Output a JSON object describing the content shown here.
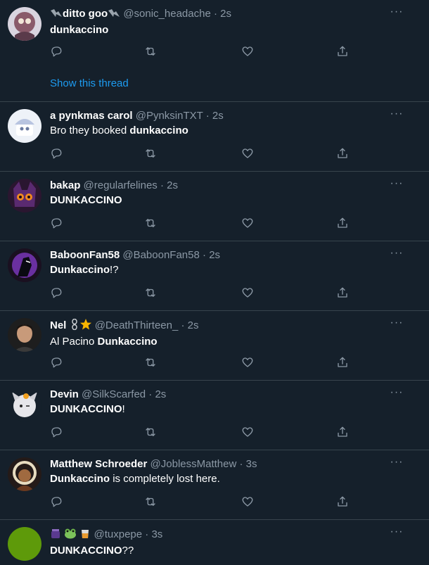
{
  "tweets": [
    {
      "name": "ditto goo",
      "handle": "@sonic_headache",
      "time": "2s",
      "pre": "",
      "bold": "dunkaccino",
      "post": "",
      "show_thread": "Show this thread",
      "avatar_color": "#7a6a8a"
    },
    {
      "name": "a pynkmas carol",
      "handle": "@PynksinTXT",
      "time": "2s",
      "pre": "Bro they booked ",
      "bold": "dunkaccino",
      "post": "",
      "avatar_color": "#cfd8e8"
    },
    {
      "name": "bakap",
      "handle": "@regularfelines",
      "time": "2s",
      "pre": "",
      "bold": "DUNKACCINO",
      "post": "",
      "avatar_color": "#3a1f3a"
    },
    {
      "name": "BaboonFan58",
      "handle": "@BaboonFan58",
      "time": "2s",
      "pre": "",
      "bold": "Dunkaccino",
      "post": "!?",
      "avatar_color": "#4a2a66"
    },
    {
      "name": "Nel",
      "handle": "@DeathThirteen_",
      "time": "2s",
      "pre": "Al Pacino ",
      "bold": "Dunkaccino",
      "post": "",
      "avatar_color": "#2b2b2b"
    },
    {
      "name": "Devin",
      "handle": "@SilkScarfed",
      "time": "2s",
      "pre": "",
      "bold": "DUNKACCINO",
      "post": "!",
      "avatar_color": "#e8e8ea"
    },
    {
      "name": "Matthew Schroeder",
      "handle": "@JoblessMatthew",
      "time": "3s",
      "pre": "",
      "bold": "Dunkaccino",
      "post": " is completely lost here.",
      "avatar_color": "#3b2a20"
    },
    {
      "name": "",
      "handle": "@tuxpepe",
      "time": "3s",
      "pre": "",
      "bold": "DUNKACCINO",
      "post": "??",
      "avatar_color": "#5e9a0a"
    }
  ],
  "ui": {
    "more": "···",
    "dot": "·"
  },
  "colors": {
    "background": "#15202b",
    "border": "#38444d",
    "secondary_text": "#8b98a5",
    "link": "#1d9bf0"
  }
}
